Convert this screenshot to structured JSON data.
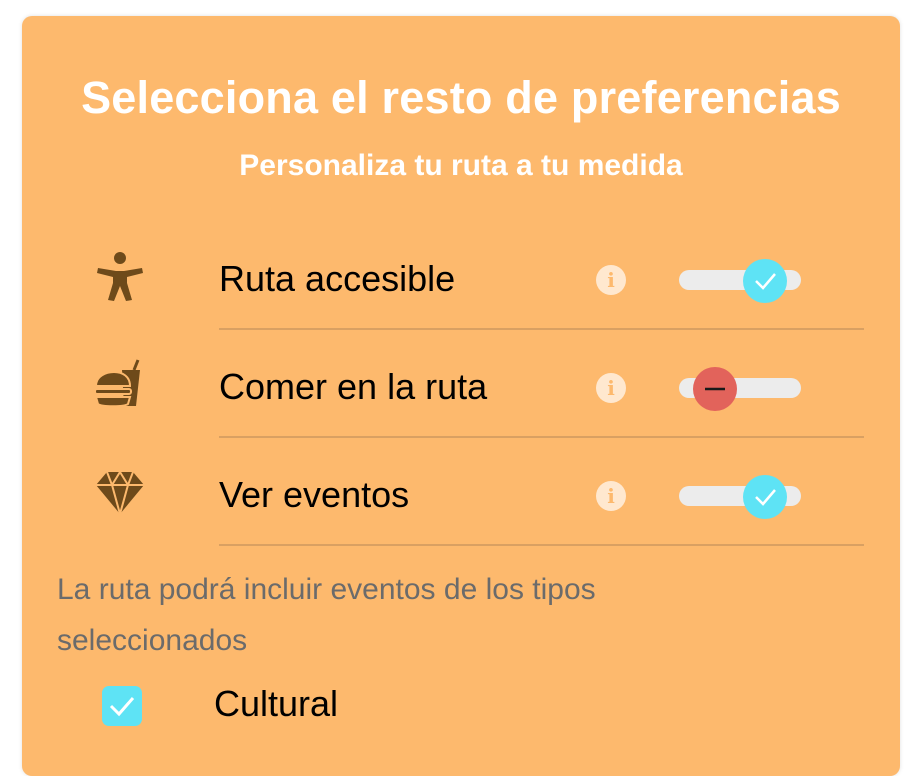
{
  "title": "Selecciona el resto de preferencias",
  "subtitle": "Personaliza tu ruta a tu medida",
  "info_glyph": "i",
  "preferences": [
    {
      "label": "Ruta accesible",
      "icon": "accessibility-person-icon",
      "state": "on"
    },
    {
      "label": "Comer en la ruta",
      "icon": "burger-drink-icon",
      "state": "off"
    },
    {
      "label": "Ver eventos",
      "icon": "diamond-icon",
      "state": "on"
    }
  ],
  "events_note": "La ruta podrá incluir eventos de los tipos seleccionados",
  "event_types": [
    {
      "label": "Cultural",
      "checked": true
    }
  ],
  "colors": {
    "card_background": "#fdb96d",
    "toggle_on": "#5ee3f5",
    "toggle_off": "#e2635b",
    "icon": "#6e4a1a"
  }
}
